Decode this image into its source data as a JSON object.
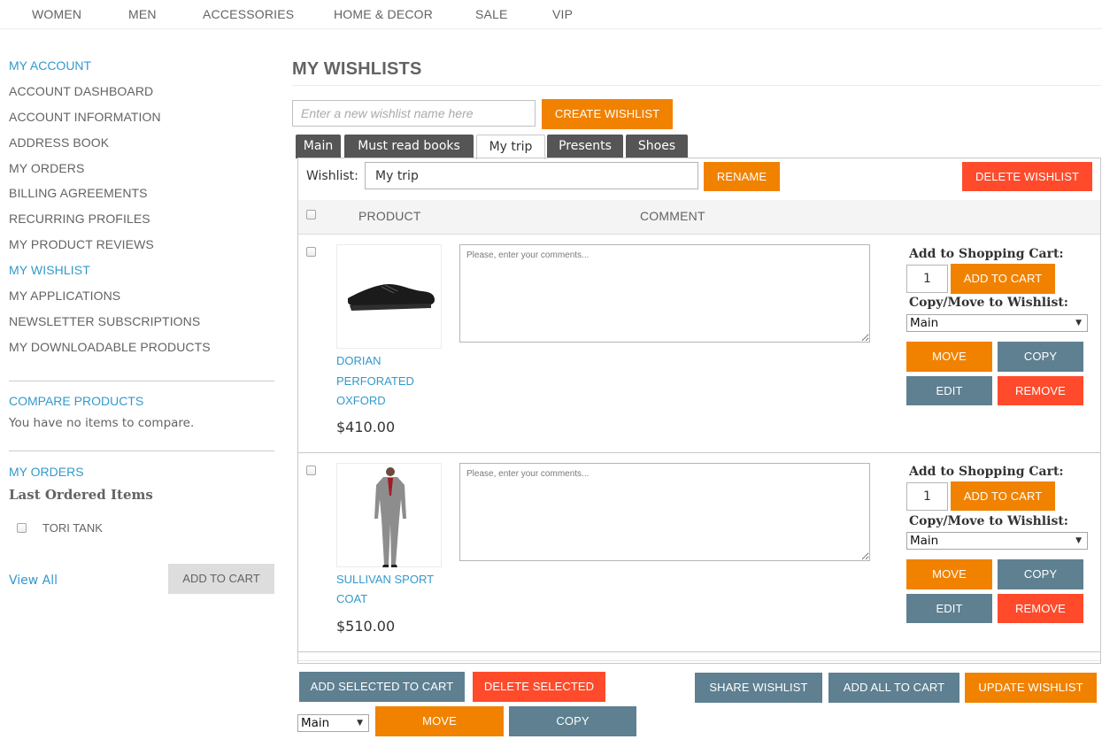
{
  "nav": [
    "WOMEN",
    "MEN",
    "ACCESSORIES",
    "HOME & DECOR",
    "SALE",
    "VIP"
  ],
  "sidebar": {
    "account_title": "MY ACCOUNT",
    "links": [
      "ACCOUNT DASHBOARD",
      "ACCOUNT INFORMATION",
      "ADDRESS BOOK",
      "MY ORDERS",
      "BILLING AGREEMENTS",
      "RECURRING PROFILES",
      "MY PRODUCT REVIEWS",
      "MY WISHLIST",
      "MY APPLICATIONS",
      "NEWSLETTER SUBSCRIPTIONS",
      "MY DOWNLOADABLE PRODUCTS"
    ],
    "active_link": "MY WISHLIST",
    "compare_title": "COMPARE PRODUCTS",
    "compare_text": "You have no items to compare.",
    "orders_title": "MY ORDERS",
    "last_ordered_title": "Last Ordered Items",
    "last_ordered_item": "TORI TANK",
    "view_all": "View All",
    "add_to_cart": "ADD TO CART"
  },
  "main": {
    "title": "MY WISHLISTS",
    "new_wishlist_placeholder": "Enter a new wishlist name here",
    "create_button": "CREATE WISHLIST",
    "tabs": [
      "Main",
      "Must read books",
      "My trip",
      "Presents",
      "Shoes"
    ],
    "active_tab": "My trip",
    "wishlist_label": "Wishlist:",
    "wishlist_name": "My trip",
    "rename_button": "RENAME",
    "delete_wishlist_button": "DELETE WISHLIST",
    "col_product": "PRODUCT",
    "col_comment": "COMMENT",
    "comment_placeholder": "Please, enter your comments...",
    "add_to_cart_label": "Add to Shopping Cart:",
    "copy_move_label": "Copy/Move to Wishlist:",
    "add_to_cart_button": "ADD TO CART",
    "move_button": "MOVE",
    "copy_button": "COPY",
    "edit_button": "EDIT",
    "remove_button": "REMOVE",
    "items": [
      {
        "name_lines": [
          "DORIAN",
          "PERFORATED",
          "OXFORD"
        ],
        "price": "$410.00",
        "qty": "1",
        "target": "Main"
      },
      {
        "name_lines": [
          "SULLIVAN SPORT",
          "COAT"
        ],
        "price": "$510.00",
        "qty": "1",
        "target": "Main"
      }
    ],
    "footer": {
      "add_selected": "ADD SELECTED TO CART",
      "delete_selected": "DELETE SELECTED",
      "share": "SHARE WISHLIST",
      "add_all": "ADD ALL TO CART",
      "update": "UPDATE WISHLIST",
      "target": "Main",
      "move": "MOVE",
      "copy": "COPY"
    }
  },
  "colors": {
    "accent_blue": "#3399cc",
    "orange": "#f18200",
    "red": "#ff4b2b",
    "slate": "#5e8091",
    "tab_dark": "#555555"
  }
}
